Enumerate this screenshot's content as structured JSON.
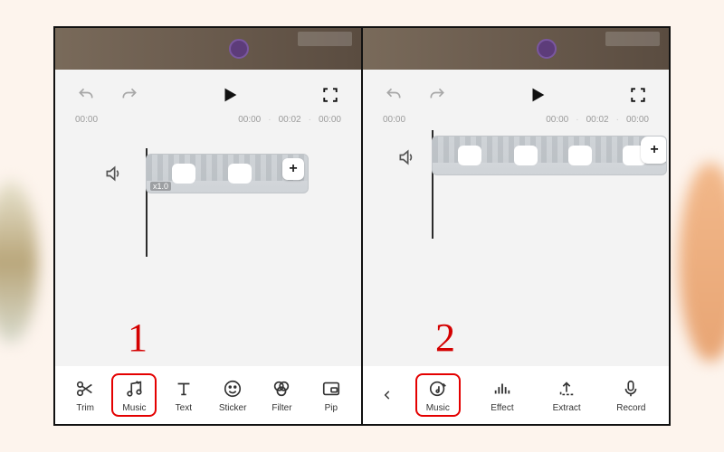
{
  "annotations": {
    "step1": "1",
    "step2": "2"
  },
  "timeline": {
    "t0": "00:00",
    "t1": "00:00",
    "t2": "00:02",
    "t3": "00:00",
    "speed": "x1.0"
  },
  "panel1": {
    "tools": {
      "trim": "Trim",
      "music": "Music",
      "text": "Text",
      "sticker": "Sticker",
      "filter": "Filter",
      "pip": "Pip"
    },
    "highlighted": "music"
  },
  "panel2": {
    "tools": {
      "music": "Music",
      "effect": "Effect",
      "extract": "Extract",
      "record": "Record"
    },
    "highlighted": "music"
  }
}
